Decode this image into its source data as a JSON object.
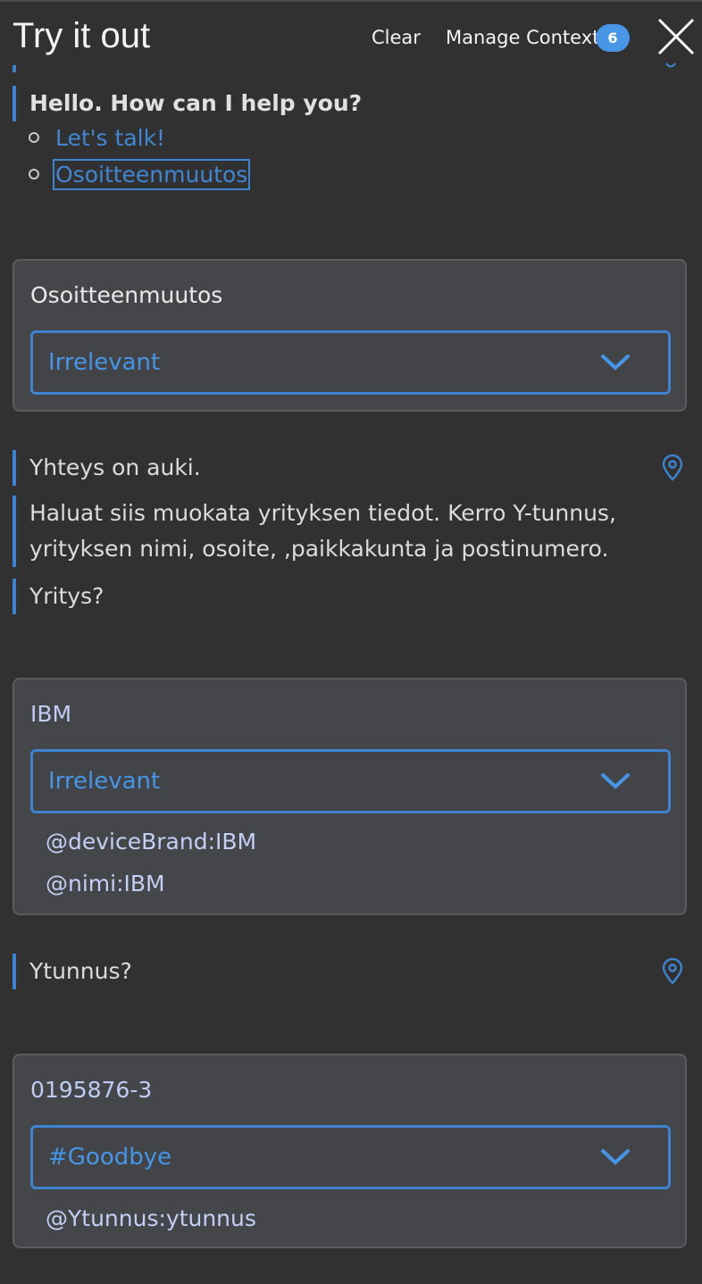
{
  "header": {
    "title": "Try it out",
    "clear_label": "Clear",
    "manage_context_label": "Manage Context",
    "context_count": "6"
  },
  "colors": {
    "background": "#313131",
    "accent": "#3d83cf",
    "link": "#4186d3",
    "card": "#444649",
    "badge": "#4796e8"
  },
  "conversation": {
    "greeting": "Hello. How can I help you?",
    "options": [
      "Let's talk!",
      "Osoitteenmuutos"
    ],
    "user_1": {
      "text": "Osoitteenmuutos",
      "intent": "Irrelevant",
      "entities": []
    },
    "bot_1": [
      "Yhteys on auki.",
      "Haluat siis muokata yrityksen tiedot. Kerro Y-tunnus, yrityksen nimi, osoite, ,paikkakunta ja postinumero.",
      "Yritys?"
    ],
    "user_2": {
      "text": "IBM",
      "intent": "Irrelevant",
      "entities": [
        "@deviceBrand:IBM",
        "@nimi:IBM"
      ]
    },
    "bot_2": [
      "Ytunnus?"
    ],
    "user_3": {
      "text": "0195876-3",
      "intent": "#Goodbye",
      "entities": [
        "@Ytunnus:ytunnus"
      ]
    }
  },
  "icons": {
    "close": "close-icon",
    "location": "location-pin-icon",
    "chevron": "chevron-down-icon"
  }
}
